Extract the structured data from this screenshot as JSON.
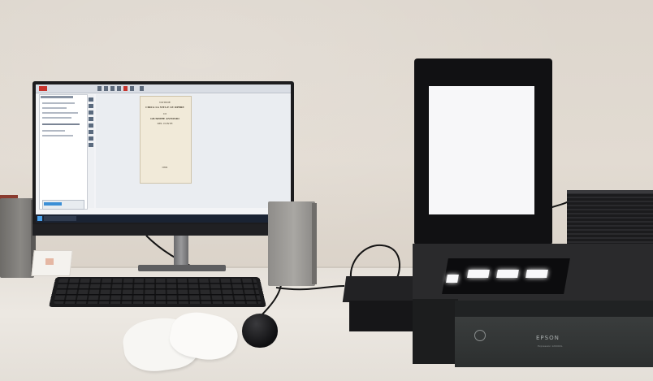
{
  "photo": {
    "description_objects": [
      "monitor",
      "scanner",
      "keyboard",
      "mouse",
      "gloves",
      "speakers",
      "external-drive",
      "pc-tower"
    ]
  },
  "screen": {
    "document_page": {
      "line1": "NOTIZIE",
      "line2": "CIRCA LA VITA E LE OPERE",
      "line3": "DI",
      "line4": "GIUSEPPE ANTONIO",
      "line5": "DEL CONTE",
      "line6": "1891"
    }
  },
  "scanner": {
    "brand": "EPSON",
    "model": "Expression 12000XL"
  }
}
